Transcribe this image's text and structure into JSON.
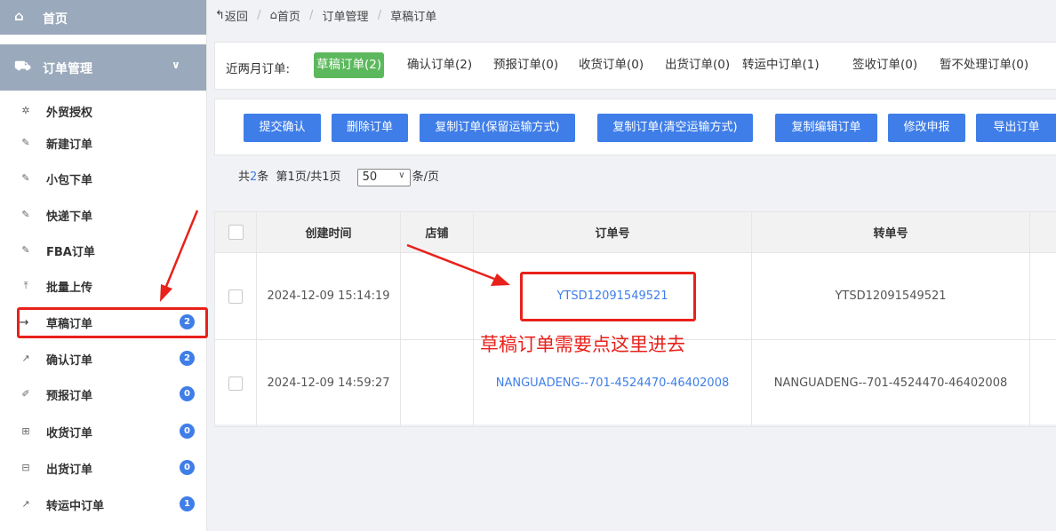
{
  "sidebar": {
    "home": {
      "label": "首页",
      "icon": "home-icon"
    },
    "menu": {
      "label": "订单管理",
      "icon": "cart-icon",
      "chevron": "chevron-down-icon"
    },
    "items": [
      {
        "label": "外贸授权",
        "icon": "gear-icon",
        "glyph": "✲"
      },
      {
        "label": "新建订单",
        "icon": "edit-icon",
        "glyph": "✎"
      },
      {
        "label": "小包下单",
        "icon": "edit-icon",
        "glyph": "✎"
      },
      {
        "label": "快递下单",
        "icon": "edit-icon",
        "glyph": "✎"
      },
      {
        "label": "FBA订单",
        "icon": "edit-icon",
        "glyph": "✎"
      },
      {
        "label": "批量上传",
        "icon": "upload-icon",
        "glyph": "⤒"
      },
      {
        "label": "草稿订单",
        "icon": "arrow-right-icon",
        "glyph": "→",
        "badge": "2",
        "active": true
      },
      {
        "label": "确认订单",
        "icon": "share-icon",
        "glyph": "↗",
        "badge": "2"
      },
      {
        "label": "预报订单",
        "icon": "pen-icon",
        "glyph": "✐",
        "badge": "0"
      },
      {
        "label": "收货订单",
        "icon": "plus-box-icon",
        "glyph": "⊞",
        "badge": "0"
      },
      {
        "label": "出货订单",
        "icon": "minus-box-icon",
        "glyph": "⊟",
        "badge": "0"
      },
      {
        "label": "转运中订单",
        "icon": "share-icon",
        "glyph": "↗",
        "badge": "1"
      }
    ]
  },
  "breadcrumb": {
    "back": "返回",
    "home": "首页",
    "section": "订单管理",
    "current": "草稿订单"
  },
  "status_bar": {
    "lead": "近两月订单:",
    "tabs": [
      {
        "label": "草稿订单(2)",
        "active": true
      },
      {
        "label": "确认订单(2)"
      },
      {
        "label": "预报订单(0)"
      },
      {
        "label": "收货订单(0)"
      },
      {
        "label": "出货订单(0)"
      },
      {
        "label": "转运中订单(1)"
      },
      {
        "label": "签收订单(0)"
      },
      {
        "label": "暂不处理订单(0)"
      }
    ]
  },
  "toolbar": {
    "buttons": [
      "提交确认",
      "删除订单",
      "复制订单(保留运输方式)",
      "复制订单(清空运输方式)",
      "复制编辑订单",
      "修改申报",
      "导出订单"
    ]
  },
  "pagination": {
    "prefix": "共",
    "count": "2",
    "mid": "条  第1页/共1页",
    "page_size": "50",
    "suffix": "条/页"
  },
  "table": {
    "headers": [
      "创建时间",
      "店铺",
      "订单号",
      "转单号"
    ],
    "rows": [
      {
        "created": "2024-12-09 15:14:19",
        "shop": "",
        "order_no": "YTSD12091549521",
        "transfer_no": "YTSD12091549521"
      },
      {
        "created": "2024-12-09 14:59:27",
        "shop": "",
        "order_no": "NANGUADENG--701-4524470-46402008",
        "transfer_no": "NANGUADENG--701-4524470-46402008"
      }
    ]
  },
  "annotation": {
    "text": "草稿订单需要点这里进去",
    "color": "#e8211b"
  },
  "colors": {
    "sidebar_header": "#9aa9bb",
    "primary": "#3f7ee8",
    "active_tab": "#5cb85c",
    "annotation": "#e8211b"
  }
}
